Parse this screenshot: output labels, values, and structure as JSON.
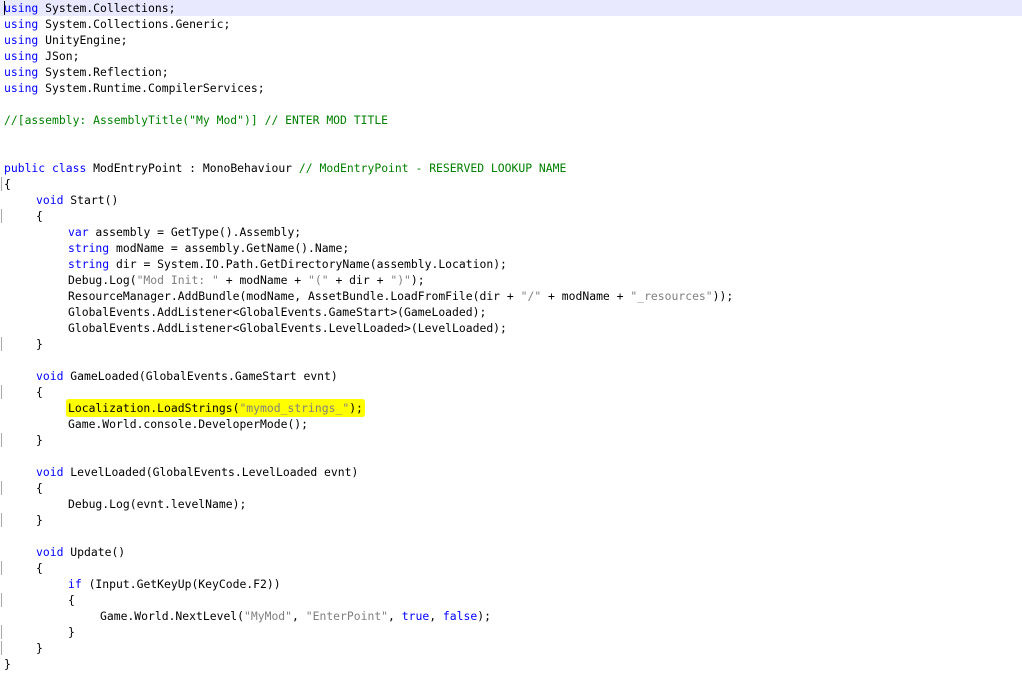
{
  "code": {
    "l1_kw": "using",
    "l1_txt": " System.Collections;",
    "l2_kw": "using",
    "l2_txt": " System.Collections.Generic;",
    "l3_kw": "using",
    "l3_txt": " UnityEngine;",
    "l4_kw": "using",
    "l4_txt": " JSon;",
    "l5_kw": "using",
    "l5_txt": " System.Reflection;",
    "l6_kw": "using",
    "l6_txt": " System.Runtime.CompilerServices;",
    "l8_comment": "//[assembly: AssemblyTitle(\"My Mod\")] // ENTER MOD TITLE",
    "l11_kw1": "public",
    "l11_kw2": "class",
    "l11_txt": " ModEntryPoint : MonoBehaviour ",
    "l11_comment": "// ModEntryPoint - RESERVED LOOKUP NAME",
    "l12": "{",
    "l13_kw": "void",
    "l13_txt": " Start()",
    "l14": "{",
    "l15_kw": "var",
    "l15_txt": " assembly = GetType().Assembly;",
    "l16_kw": "string",
    "l16_txt": " modName = assembly.GetName().Name;",
    "l17_kw": "string",
    "l17_txt": " dir = System.IO.Path.GetDirectoryName(assembly.Location);",
    "l18_a": "Debug.Log(",
    "l18_s1": "\"Mod Init: \"",
    "l18_b": " + modName + ",
    "l18_s2": "\"(\"",
    "l18_c": " + dir + ",
    "l18_s3": "\")\"",
    "l18_d": ");",
    "l19_a": "ResourceManager.AddBundle(modName, AssetBundle.LoadFromFile(dir + ",
    "l19_s1": "\"/\"",
    "l19_b": " + modName + ",
    "l19_s2": "\"_resources\"",
    "l19_c": "));",
    "l20": "GlobalEvents.AddListener<GlobalEvents.GameStart>(GameLoaded);",
    "l21": "GlobalEvents.AddListener<GlobalEvents.LevelLoaded>(LevelLoaded);",
    "l22": "}",
    "l24_kw": "void",
    "l24_txt": " GameLoaded(GlobalEvents.GameStart evnt)",
    "l25": "{",
    "l26_a": "Localization.LoadStrings(",
    "l26_s": "\"mymod_strings_\"",
    "l26_b": ");",
    "l27": "Game.World.console.DeveloperMode();",
    "l28": "}",
    "l30_kw": "void",
    "l30_txt": " LevelLoaded(GlobalEvents.LevelLoaded evnt)",
    "l31": "{",
    "l32": "Debug.Log(evnt.levelName);",
    "l33": "}",
    "l35_kw": "void",
    "l35_txt": " Update()",
    "l36": "{",
    "l37_kw": "if",
    "l37_txt": " (Input.GetKeyUp(KeyCode.F2))",
    "l38": "{",
    "l39_a": "Game.World.NextLevel(",
    "l39_s1": "\"MyMod\"",
    "l39_b": ", ",
    "l39_s2": "\"EnterPoint\"",
    "l39_c": ", ",
    "l39_k1": "true",
    "l39_d": ", ",
    "l39_k2": "false",
    "l39_e": ");",
    "l40": "}",
    "l41": "}",
    "l42": "}"
  },
  "colors": {
    "keyword": "#0000ff",
    "comment": "#008000",
    "string": "#808080",
    "highlight": "#ffff00",
    "current_line": "#e8e8ff"
  }
}
